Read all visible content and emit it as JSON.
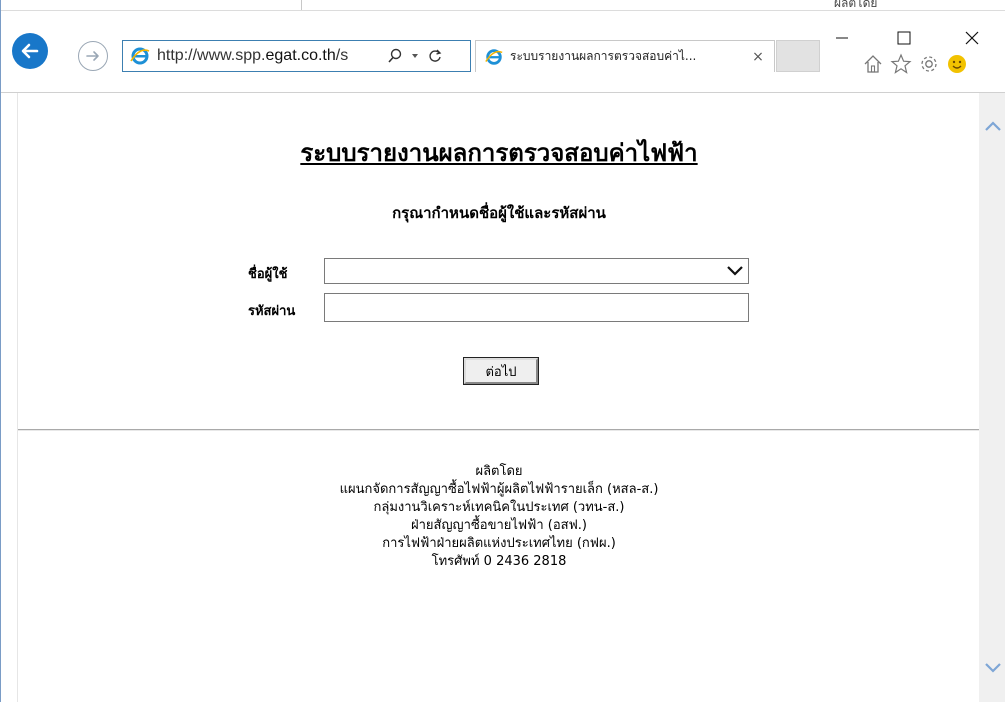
{
  "background_window": {
    "partial_text": "ผลิตโดย"
  },
  "browser": {
    "address": {
      "url_prefix": "http://www.spp.",
      "url_domain": "egat.co.th",
      "url_suffix": "/s"
    },
    "tab": {
      "title": "ระบบรายงานผลการตรวจสอบค่าไ...",
      "close_glyph": "×"
    },
    "window_controls": {
      "minimize": "–",
      "maximize": "☐",
      "close": "✕"
    },
    "icons": [
      "back-icon",
      "forward-icon",
      "ie-logo-icon",
      "search-icon",
      "dropdown-icon",
      "refresh-icon",
      "home-icon",
      "favorites-star-icon",
      "settings-gear-icon",
      "smiley-feedback-icon"
    ]
  },
  "page": {
    "heading": "ระบบรายงานผลการตรวจสอบค่าไฟฟ้า",
    "subheading": "กรุณากำหนดชื่อผู้ใช้และรหัสผ่าน",
    "form": {
      "username_label": "ชื่อผู้ใช้",
      "username_value": "",
      "password_label": "รหัสผ่าน",
      "password_value": "",
      "submit_label": "ต่อไป"
    },
    "credits": [
      "ผลิตโดย",
      "แผนกจัดการสัญญาซื้อไฟฟ้าผู้ผลิตไฟฟ้ารายเล็ก (หสล-ส.)",
      "กลุ่มงานวิเคราะห์เทคนิคในประเทศ (วทน-ส.)",
      "ฝ่ายสัญญาซื้อขายไฟฟ้า (อสฟ.)",
      "การไฟฟ้าฝ่ายผลิตแห่งประเทศไทย (กฟผ.)",
      "โทรศัพท์ 0 2436 2818"
    ]
  },
  "colors": {
    "accent": "#1877c9",
    "address_border": "#3c7fb1",
    "ie_logo": "#1e90d6",
    "smiley": "#f2c200"
  }
}
